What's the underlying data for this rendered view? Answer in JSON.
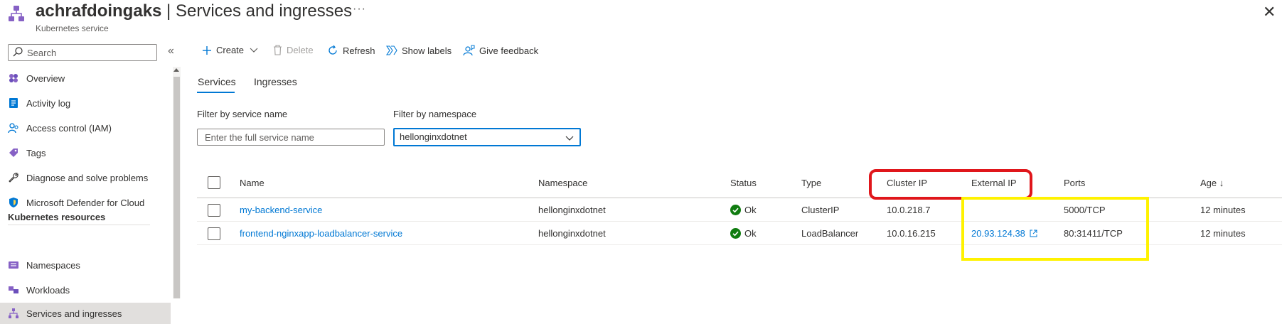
{
  "header": {
    "resource_name": "achrafdoingaks",
    "separator": " | ",
    "page_name": "Services and ingresses",
    "subtitle": "Kubernetes service",
    "more_label": "···",
    "close_label": "✕"
  },
  "sidebar": {
    "search_placeholder": "Search",
    "collapse_label": "«",
    "items": [
      {
        "label": "Overview",
        "icon": "overview-icon"
      },
      {
        "label": "Activity log",
        "icon": "activity-log-icon"
      },
      {
        "label": "Access control (IAM)",
        "icon": "people-icon"
      },
      {
        "label": "Tags",
        "icon": "tag-icon"
      },
      {
        "label": "Diagnose and solve problems",
        "icon": "wrench-icon"
      },
      {
        "label": "Microsoft Defender for Cloud",
        "icon": "shield-icon"
      }
    ],
    "section_title": "Kubernetes resources",
    "section_items": [
      {
        "label": "Namespaces",
        "icon": "namespaces-icon"
      },
      {
        "label": "Workloads",
        "icon": "workloads-icon"
      },
      {
        "label": "Services and ingresses",
        "icon": "network-icon",
        "active": true
      }
    ]
  },
  "toolbar": {
    "create": "Create",
    "delete": "Delete",
    "refresh": "Refresh",
    "show_labels": "Show labels",
    "give_feedback": "Give feedback"
  },
  "tabs": {
    "services": "Services",
    "ingresses": "Ingresses"
  },
  "filters": {
    "service_name_label": "Filter by service name",
    "service_name_placeholder": "Enter the full service name",
    "namespace_label": "Filter by namespace",
    "namespace_value": "hellonginxdotnet"
  },
  "table": {
    "columns": {
      "name": "Name",
      "namespace": "Namespace",
      "status": "Status",
      "type": "Type",
      "cluster_ip": "Cluster IP",
      "external_ip": "External IP",
      "ports": "Ports",
      "age": "Age ↓"
    },
    "rows": [
      {
        "name": "my-backend-service",
        "namespace": "hellonginxdotnet",
        "status": "Ok",
        "type": "ClusterIP",
        "cluster_ip": "10.0.218.7",
        "external_ip": "",
        "ports": "5000/TCP",
        "age": "12 minutes"
      },
      {
        "name": "frontend-nginxapp-loadbalancer-service",
        "namespace": "hellonginxdotnet",
        "status": "Ok",
        "type": "LoadBalancer",
        "cluster_ip": "10.0.16.215",
        "external_ip": "20.93.124.38",
        "ports": "80:31411/TCP",
        "age": "12 minutes"
      }
    ]
  },
  "colors": {
    "accent": "#0078d4",
    "ok_green": "#107c10",
    "annotation_red": "#e0161b",
    "annotation_yellow": "#fff200"
  }
}
